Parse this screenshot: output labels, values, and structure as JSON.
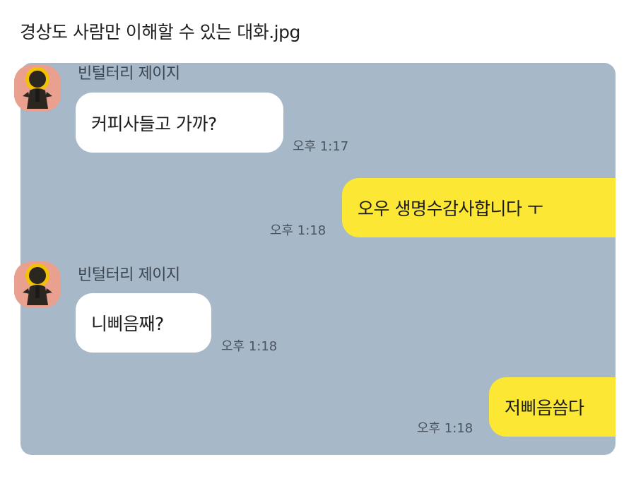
{
  "post": {
    "title": "경상도 사람만 이해할 수 있는 대화.jpg"
  },
  "messages": [
    {
      "direction": "in",
      "sender": "빈털터리 제이지",
      "text": "커피사들고 가까?",
      "time": "오후 1:17"
    },
    {
      "direction": "out",
      "text": "오우 생명수감사합니다 ㅜ",
      "time": "오후 1:18"
    },
    {
      "direction": "in",
      "sender": "빈털터리 제이지",
      "text": "니삐음째?",
      "time": "오후 1:18"
    },
    {
      "direction": "out",
      "text": "저삐음씀다",
      "time": "오후 1:18"
    }
  ],
  "colors": {
    "chat_background": "#a7b8c9",
    "incoming_bubble": "#ffffff",
    "outgoing_bubble": "#fbe734",
    "avatar_background": "#e9a08f"
  }
}
